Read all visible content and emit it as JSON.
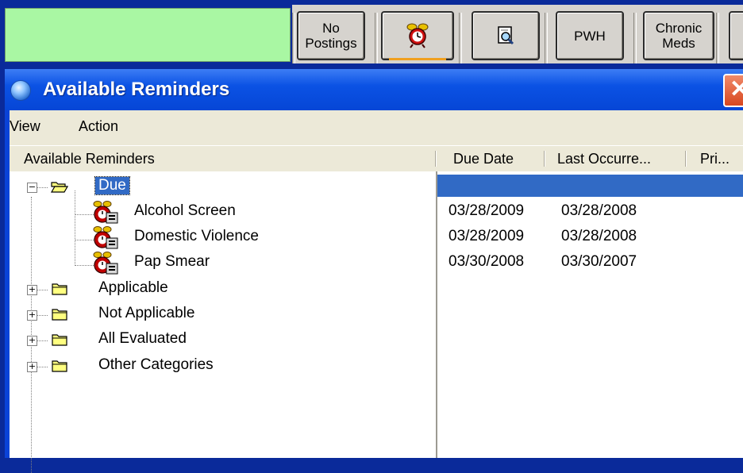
{
  "toolbar": {
    "buttons": [
      {
        "label": "No\nPostings"
      },
      {
        "icon": "alarm-clock-icon"
      },
      {
        "icon": "magnifier-report-icon"
      },
      {
        "label": "PWH"
      },
      {
        "label": "Chronic\nMeds"
      }
    ]
  },
  "dialog": {
    "title": "Available Reminders",
    "close_label": "✕",
    "menu": [
      "View",
      "Action"
    ],
    "columns": [
      "Available Reminders",
      "Due Date",
      "Last Occurre...",
      "Pri..."
    ],
    "tree": {
      "due": {
        "label": "Due",
        "expanded": true
      },
      "reminders": [
        {
          "name": "Alcohol Screen",
          "due_date": "03/28/2009",
          "last_occurrence": "03/28/2008"
        },
        {
          "name": "Domestic Violence",
          "due_date": "03/28/2009",
          "last_occurrence": "03/28/2008"
        },
        {
          "name": "Pap Smear",
          "due_date": "03/30/2008",
          "last_occurrence": "03/30/2007"
        }
      ],
      "categories": [
        {
          "label": "Applicable"
        },
        {
          "label": "Not Applicable"
        },
        {
          "label": "All Evaluated"
        },
        {
          "label": "Other Categories"
        }
      ]
    }
  },
  "colors": {
    "desktop": "#0a2a9a",
    "green_panel": "#a9f7a3",
    "title_bar": "#0b52e4",
    "selection": "#316ac5",
    "folder": "#ffff80"
  }
}
